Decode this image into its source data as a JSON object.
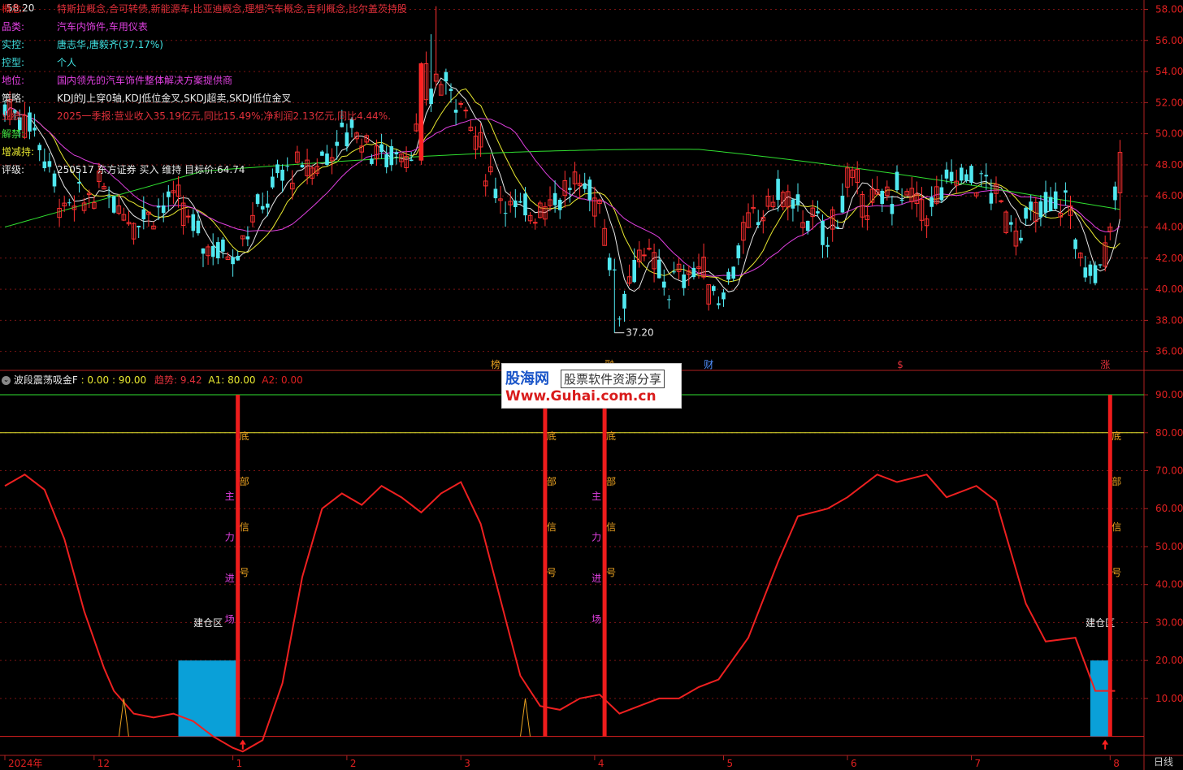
{
  "info_panel": [
    {
      "key": "概念:",
      "value": "特斯拉概念,合可转债,新能源车,比亚迪概念,理想汽车概念,吉利概念,比尔盖茨持股",
      "color": "#e0303a",
      "key_color": "#e02020"
    },
    {
      "key": "品类:",
      "value": "汽车内饰件,车用仪表",
      "color": "#e040e0",
      "key_color": "#e040e0"
    },
    {
      "key": "实控:",
      "value": "唐志华,唐毅齐(37.17%)",
      "color": "#40e0e0",
      "key_color": "#40e0e0"
    },
    {
      "key": "控型:",
      "value": "个人",
      "color": "#40e0e0",
      "key_color": "#40e0e0"
    },
    {
      "key": "地位:",
      "value": "国内领先的汽车饰件整体解决方案提供商",
      "color": "#e040e0",
      "key_color": "#e040e0"
    },
    {
      "key": "策略:",
      "value": "KDJ的J上穿0轴,KDJ低位金叉,SKDJ超卖,SKDJ低位金叉",
      "color": "#e8e8e8",
      "key_color": "#e8e8e8"
    },
    {
      "key": "业绩:",
      "value": "2025一季报:营业收入35.19亿元,同比15.49%;净利润2.13亿元,同比4.44%.",
      "color": "#e0303a",
      "key_color": "#e0303a"
    },
    {
      "key": "解禁:",
      "value": "",
      "color": "#40e040",
      "key_color": "#40e040"
    },
    {
      "key": "增减持:",
      "value": "",
      "color": "#e8e830",
      "key_color": "#e8e830"
    },
    {
      "key": "评级:",
      "value": "250517 东方证券 买入 维持 目标价:64.74",
      "color": "#e8e8e8",
      "key_color": "#e8e8e8"
    }
  ],
  "top_price_label": "58.20",
  "low_price_label": "37.20",
  "event_markers": [
    {
      "text": "榜",
      "date_index": 99,
      "color": "#e8a020"
    },
    {
      "text": "融",
      "date_index": 122,
      "color": "#e8a020"
    },
    {
      "text": "财",
      "date_index": 142,
      "color": "#5090ff"
    },
    {
      "text": "$",
      "date_index": 181,
      "color": "#e0303a"
    },
    {
      "text": "涨",
      "date_index": 222,
      "color": "#e0303a"
    }
  ],
  "indicator": {
    "name": "波段震荡吸金F",
    "params": ": 0.00 : 90.00",
    "trend_label": "趋势: 9.42",
    "a1_label": "A1: 80.00",
    "a2_label": "A2: 0.00"
  },
  "x_axis_labels": [
    {
      "text": "2024年",
      "date_index": 0
    },
    {
      "text": "12",
      "date_index": 18
    },
    {
      "text": "1",
      "date_index": 46
    },
    {
      "text": "2",
      "date_index": 69
    },
    {
      "text": "3",
      "date_index": 92
    },
    {
      "text": "4",
      "date_index": 119
    },
    {
      "text": "5",
      "date_index": 145
    },
    {
      "text": "6",
      "date_index": 170
    },
    {
      "text": "7",
      "date_index": 195
    },
    {
      "text": "8",
      "date_index": 223
    }
  ],
  "period_label": "日线",
  "watermark": {
    "brand": "股海网",
    "slogan": "股票软件资源分享",
    "url": "Www.Guhai.com.cn"
  },
  "chart_data": [
    {
      "type": "candlestick",
      "title": "",
      "ylim": [
        35.2,
        58.6
      ],
      "yticks": [
        36.0,
        38.0,
        40.0,
        42.0,
        44.0,
        46.0,
        48.0,
        50.0,
        52.0,
        54.0,
        56.0,
        58.0
      ],
      "grid": true,
      "num_bars": 226,
      "anchors": [
        [
          0,
          51.8
        ],
        [
          6,
          50.5
        ],
        [
          12,
          45.0
        ],
        [
          20,
          46.5
        ],
        [
          26,
          44.5
        ],
        [
          34,
          45.8
        ],
        [
          40,
          43.0
        ],
        [
          46,
          42.3
        ],
        [
          50,
          44.5
        ],
        [
          56,
          47.5
        ],
        [
          62,
          47.8
        ],
        [
          70,
          50.5
        ],
        [
          76,
          48.5
        ],
        [
          82,
          49.0
        ],
        [
          87,
          53.5
        ],
        [
          92,
          52.5
        ],
        [
          98,
          47.0
        ],
        [
          104,
          44.8
        ],
        [
          110,
          45.8
        ],
        [
          116,
          46.8
        ],
        [
          120,
          45.5
        ],
        [
          124,
          39.0
        ],
        [
          128,
          42.5
        ],
        [
          134,
          40.2
        ],
        [
          140,
          41.5
        ],
        [
          144,
          39.2
        ],
        [
          150,
          44.0
        ],
        [
          156,
          46.2
        ],
        [
          162,
          44.5
        ],
        [
          166,
          43.3
        ],
        [
          170,
          46.8
        ],
        [
          176,
          45.3
        ],
        [
          180,
          46.5
        ],
        [
          186,
          45.0
        ],
        [
          192,
          47.5
        ],
        [
          198,
          46.8
        ],
        [
          204,
          43.8
        ],
        [
          210,
          45.2
        ],
        [
          214,
          45.8
        ],
        [
          218,
          41.0
        ],
        [
          221,
          41.2
        ],
        [
          224,
          46.2
        ],
        [
          225,
          48.5
        ]
      ],
      "ma_lines": [
        {
          "name": "",
          "color": "#e8e8e8",
          "period": 5
        },
        {
          "name": "",
          "color": "#e8e830",
          "period": 10
        },
        {
          "name": "",
          "color": "#e040e0",
          "period": 20
        },
        {
          "name": "",
          "color": "#30e030",
          "period": 60
        }
      ]
    },
    {
      "type": "line",
      "title": "波段震荡吸金F",
      "ylim": [
        -5,
        96
      ],
      "yticks": [
        10.0,
        20.0,
        30.0,
        40.0,
        50.0,
        60.0,
        70.0,
        80.0,
        90.0
      ],
      "hlines": [
        {
          "y": 90,
          "color": "#30e030"
        },
        {
          "y": 80,
          "color": "#e8e830"
        },
        {
          "y": 0,
          "color": "#e02020"
        }
      ],
      "series": [
        {
          "name": "",
          "color": "#ee2020",
          "x": [
            0,
            4,
            8,
            12,
            16,
            20,
            22,
            26,
            30,
            34,
            38,
            42,
            46,
            48,
            52,
            56,
            60,
            64,
            68,
            72,
            76,
            80,
            84,
            88,
            92,
            96,
            100,
            104,
            108,
            112,
            116,
            120,
            124,
            128,
            132,
            136,
            140,
            144,
            150,
            156,
            160,
            166,
            170,
            176,
            180,
            186,
            190,
            196,
            200,
            206,
            210,
            216,
            220,
            224
          ],
          "values": [
            66,
            69,
            65,
            52,
            33,
            18,
            12,
            6,
            5,
            6,
            4,
            0,
            -3,
            -4,
            -1,
            14,
            42,
            60,
            64,
            61,
            66,
            63,
            59,
            64,
            67,
            56,
            36,
            16,
            8,
            7,
            10,
            11,
            6,
            8,
            10,
            10,
            13,
            15,
            26,
            46,
            58,
            60,
            63,
            69,
            67,
            69,
            63,
            66,
            62,
            35,
            25,
            26,
            12,
            12
          ]
        }
      ],
      "bars": [
        {
          "type": "entry_zone",
          "label": "建仓区",
          "x_start": 35,
          "x_end": 47,
          "y_top": 20,
          "y_bottom": 0,
          "color": "#0aa0d8"
        },
        {
          "type": "entry_zone",
          "label": "建仓区",
          "x_start": 219,
          "x_end": 223,
          "y_top": 20,
          "y_bottom": 0,
          "color": "#0aa0d8"
        }
      ],
      "signals": [
        {
          "x": 47,
          "label_left": [
            "底",
            "部",
            "信",
            "号"
          ],
          "label_right": [
            "主",
            "力",
            "进",
            "场"
          ]
        },
        {
          "x": 109,
          "label_left": [
            "底",
            "部",
            "信",
            "号"
          ],
          "label_right": []
        },
        {
          "x": 121,
          "label_left": [
            "底",
            "部",
            "信",
            "号"
          ],
          "label_right": [
            "主",
            "力",
            "进",
            "场"
          ]
        },
        {
          "x": 223,
          "label_left": [
            "底",
            "部",
            "信",
            "号"
          ],
          "label_right": []
        }
      ],
      "triangles": [
        {
          "x": 24,
          "height": 10
        },
        {
          "x": 105,
          "height": 10
        }
      ],
      "up_arrows": [
        {
          "x": 48
        },
        {
          "x": 222
        }
      ]
    }
  ]
}
